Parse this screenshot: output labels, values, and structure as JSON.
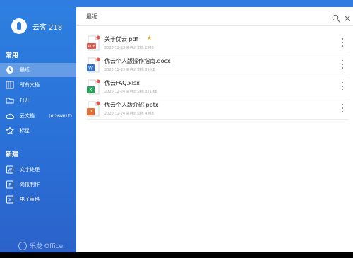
{
  "account": {
    "name": "云客 218"
  },
  "sidebar": {
    "common_title": "常用",
    "items": [
      {
        "label": "最近",
        "icon": "clock-icon",
        "active": true
      },
      {
        "label": "所有文档",
        "icon": "documents-icon"
      },
      {
        "label": "打开",
        "icon": "folder-open-icon"
      },
      {
        "label": "云文档",
        "icon": "cloud-icon",
        "badge": "(6.26M/1T)"
      },
      {
        "label": "标星",
        "icon": "star-icon"
      }
    ],
    "new_title": "新建",
    "new_items": [
      {
        "label": "文字处理",
        "icon": "word-doc-icon"
      },
      {
        "label": "简报制作",
        "icon": "presentation-icon"
      },
      {
        "label": "电子表格",
        "icon": "spreadsheet-icon"
      }
    ],
    "logo_text": "乐龙 Office"
  },
  "header": {
    "title": "最近"
  },
  "files": [
    {
      "name": "关于优云.pdf",
      "type": "pdf",
      "type_label": "PDF",
      "meta": "2020-12-23   来自云文档   1 MB",
      "starred": true
    },
    {
      "name": "优云个人版操作指南.docx",
      "type": "docx",
      "type_label": "W",
      "meta": "2020-12-23   来自云文档   39 KB",
      "starred": false
    },
    {
      "name": "优云FAQ.xlsx",
      "type": "xlsx",
      "type_label": "X",
      "meta": "2020-12-24   来自云文档   321 KB",
      "starred": false
    },
    {
      "name": "优云个人版介绍.pptx",
      "type": "pptx",
      "type_label": "P",
      "meta": "2020-12-24   来自云文档   4 MB",
      "starred": false
    }
  ],
  "colors": {
    "sidebar": "#2d7fe0",
    "pdf": "#e8534a",
    "docx": "#2f6fd6",
    "xlsx": "#26a05a",
    "pptx": "#ec6b2d",
    "star": "#f5a623"
  }
}
